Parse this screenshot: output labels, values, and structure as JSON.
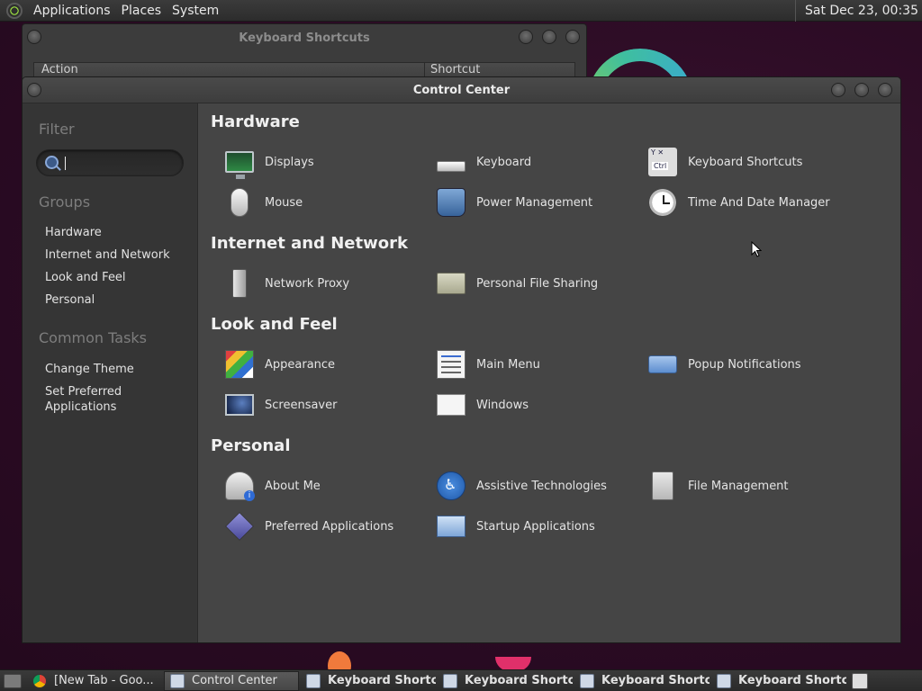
{
  "top_panel": {
    "menus": [
      "Applications",
      "Places",
      "System"
    ],
    "clock": "Sat Dec 23, 00:35"
  },
  "background_window": {
    "title": "Keyboard Shortcuts",
    "columns": [
      "Action",
      "Shortcut"
    ]
  },
  "window": {
    "title": "Control Center"
  },
  "sidebar": {
    "filter_heading": "Filter",
    "search": {
      "value": "",
      "placeholder": ""
    },
    "groups_heading": "Groups",
    "groups": [
      "Hardware",
      "Internet and Network",
      "Look and Feel",
      "Personal"
    ],
    "tasks_heading": "Common Tasks",
    "tasks": [
      "Change Theme",
      "Set Preferred Applications"
    ]
  },
  "sections": [
    {
      "title": "Hardware",
      "items": [
        {
          "label": "Displays",
          "icon": "display-icon"
        },
        {
          "label": "Keyboard",
          "icon": "keyboard-icon"
        },
        {
          "label": "Keyboard Shortcuts",
          "icon": "keyboard-shortcuts-icon"
        },
        {
          "label": "Mouse",
          "icon": "mouse-icon"
        },
        {
          "label": "Power Management",
          "icon": "power-management-icon"
        },
        {
          "label": "Time And Date Manager",
          "icon": "clock-icon"
        }
      ]
    },
    {
      "title": "Internet and Network",
      "items": [
        {
          "label": "Network Proxy",
          "icon": "network-proxy-icon"
        },
        {
          "label": "Personal File Sharing",
          "icon": "folder-icon"
        }
      ]
    },
    {
      "title": "Look and Feel",
      "items": [
        {
          "label": "Appearance",
          "icon": "appearance-icon"
        },
        {
          "label": "Main Menu",
          "icon": "main-menu-icon"
        },
        {
          "label": "Popup Notifications",
          "icon": "popup-notifications-icon"
        },
        {
          "label": "Screensaver",
          "icon": "screensaver-icon"
        },
        {
          "label": "Windows",
          "icon": "windows-icon"
        }
      ]
    },
    {
      "title": "Personal",
      "items": [
        {
          "label": "About Me",
          "icon": "about-me-icon"
        },
        {
          "label": "Assistive Technologies",
          "icon": "accessibility-icon"
        },
        {
          "label": "File Management",
          "icon": "file-management-icon"
        },
        {
          "label": "Preferred Applications",
          "icon": "preferred-applications-icon"
        },
        {
          "label": "Startup Applications",
          "icon": "startup-applications-icon"
        }
      ]
    }
  ],
  "taskbar": {
    "tasks": [
      {
        "label": "[New Tab - Goo...",
        "icon": "chrome-icon"
      },
      {
        "label": "Control Center",
        "icon": "control-center-icon"
      },
      {
        "label": "Keyboard Shortc...",
        "icon": "keyboard-shortcuts-icon"
      },
      {
        "label": "Keyboard Shortc...",
        "icon": "keyboard-shortcuts-icon"
      },
      {
        "label": "Keyboard Shortc...",
        "icon": "keyboard-shortcuts-icon"
      },
      {
        "label": "Keyboard Shortc...",
        "icon": "keyboard-shortcuts-icon"
      }
    ]
  }
}
